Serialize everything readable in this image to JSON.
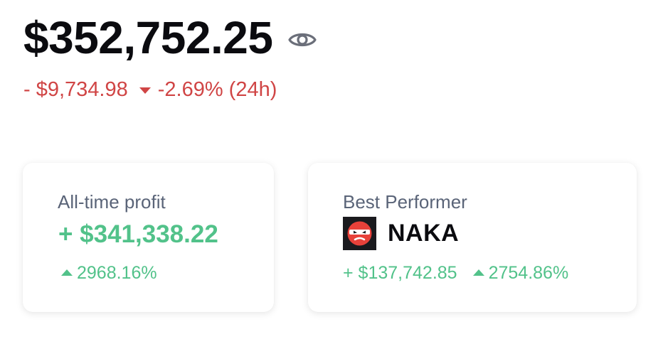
{
  "portfolio": {
    "balance": "$352,752.25",
    "visibility_icon": "eye-icon",
    "change_amount": "- $9,734.98",
    "change_percent": "-2.69% (24h)",
    "change_direction": "down",
    "colors": {
      "negative": "#d04545",
      "positive": "#52c28a"
    }
  },
  "profit_card": {
    "label": "All-time profit",
    "value": "+ $341,338.22",
    "percent": "2968.16%",
    "direction": "up"
  },
  "best_performer_card": {
    "label": "Best Performer",
    "token_logo_icon": "naka-token-logo-icon",
    "token_name": "NAKA",
    "gain_amount": "+ $137,742.85",
    "gain_percent": "2754.86%",
    "direction": "up"
  }
}
